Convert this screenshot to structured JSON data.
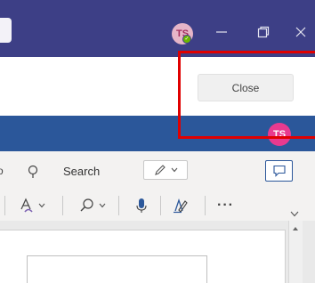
{
  "titlebar": {
    "avatar_initials": "TS",
    "status": "available",
    "status_check": "✓",
    "minimize_glyph": "—",
    "restore_glyph": "❐",
    "close_glyph": "✕"
  },
  "meeting": {
    "close_label": "Close",
    "avatar_initials": "TS"
  },
  "ribbon": {
    "partial_tab": "o",
    "search_label": "Search"
  },
  "toolbar": {
    "more_label": "···"
  },
  "colors": {
    "titlebar": "#3d3f86",
    "band": "#2b579a",
    "avatar_band": "#e83a8f",
    "annotation": "#e00000",
    "status_green": "#6bb700"
  },
  "icons": [
    "search-icon",
    "pen-icon",
    "comment-icon",
    "font-color-icon",
    "find-icon",
    "dictate-mic-icon",
    "editor-icon",
    "more-icon"
  ]
}
